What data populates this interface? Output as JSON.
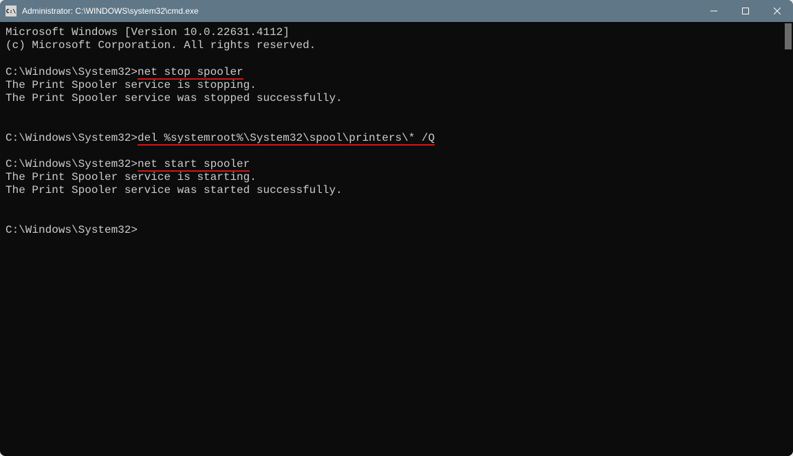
{
  "window": {
    "icon_text": "C:\\",
    "title": "Administrator: C:\\WINDOWS\\system32\\cmd.exe"
  },
  "terminal": {
    "banner_line1": "Microsoft Windows [Version 10.0.22631.4112]",
    "banner_line2": "(c) Microsoft Corporation. All rights reserved.",
    "prompt1_path": "C:\\Windows\\System32>",
    "cmd1": "net stop spooler",
    "out1_line1": "The Print Spooler service is stopping.",
    "out1_line2": "The Print Spooler service was stopped successfully.",
    "prompt2_path": "C:\\Windows\\System32>",
    "cmd2": "del %systemroot%\\System32\\spool\\printers\\* /Q",
    "prompt3_path": "C:\\Windows\\System32>",
    "cmd3": "net start spooler",
    "out3_line1": "The Print Spooler service is starting.",
    "out3_line2": "The Print Spooler service was started successfully.",
    "prompt4_path": "C:\\Windows\\System32>"
  }
}
